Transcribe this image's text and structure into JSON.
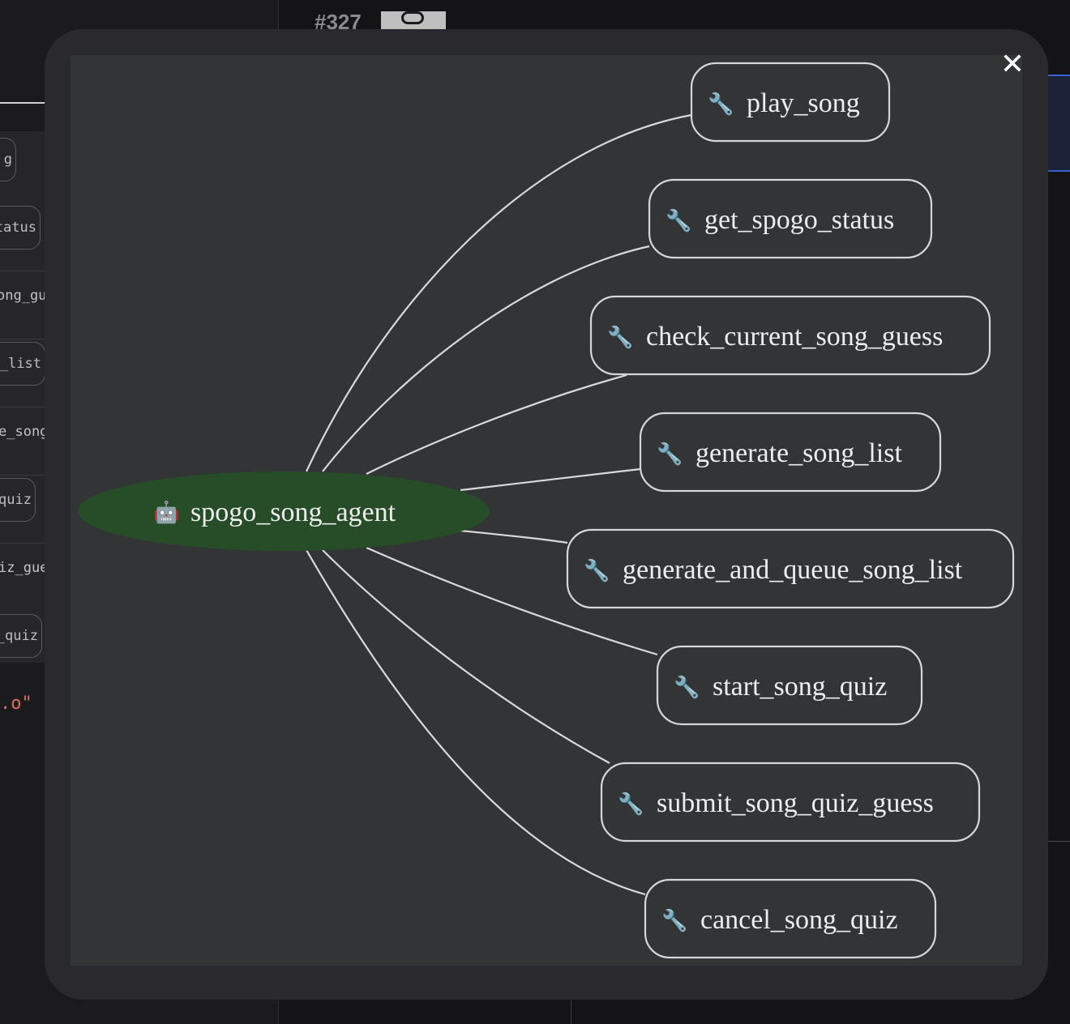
{
  "background": {
    "page_id": "#327",
    "side_pills": [
      "g",
      "tatus",
      "ong_gu",
      "g_list",
      "e_song",
      "quiz",
      "iz_gue",
      "_quiz"
    ],
    "red_fragment": ".o\""
  },
  "modal": {
    "close_label": "✕",
    "graph": {
      "root": {
        "label": "spogo_song_agent",
        "icon": "robot-icon",
        "emoji": "🤖",
        "fill": "#264d28"
      },
      "tool_icon": "wrench-icon",
      "tool_emoji": "🔧",
      "edge_color": "#d9d9d9",
      "node_border": "#d6d6d6",
      "tools": [
        {
          "label": "play_song"
        },
        {
          "label": "get_spogo_status"
        },
        {
          "label": "check_current_song_guess"
        },
        {
          "label": "generate_song_list"
        },
        {
          "label": "generate_and_queue_song_list"
        },
        {
          "label": "start_song_quiz"
        },
        {
          "label": "submit_song_quiz_guess"
        },
        {
          "label": "cancel_song_quiz"
        }
      ]
    }
  }
}
